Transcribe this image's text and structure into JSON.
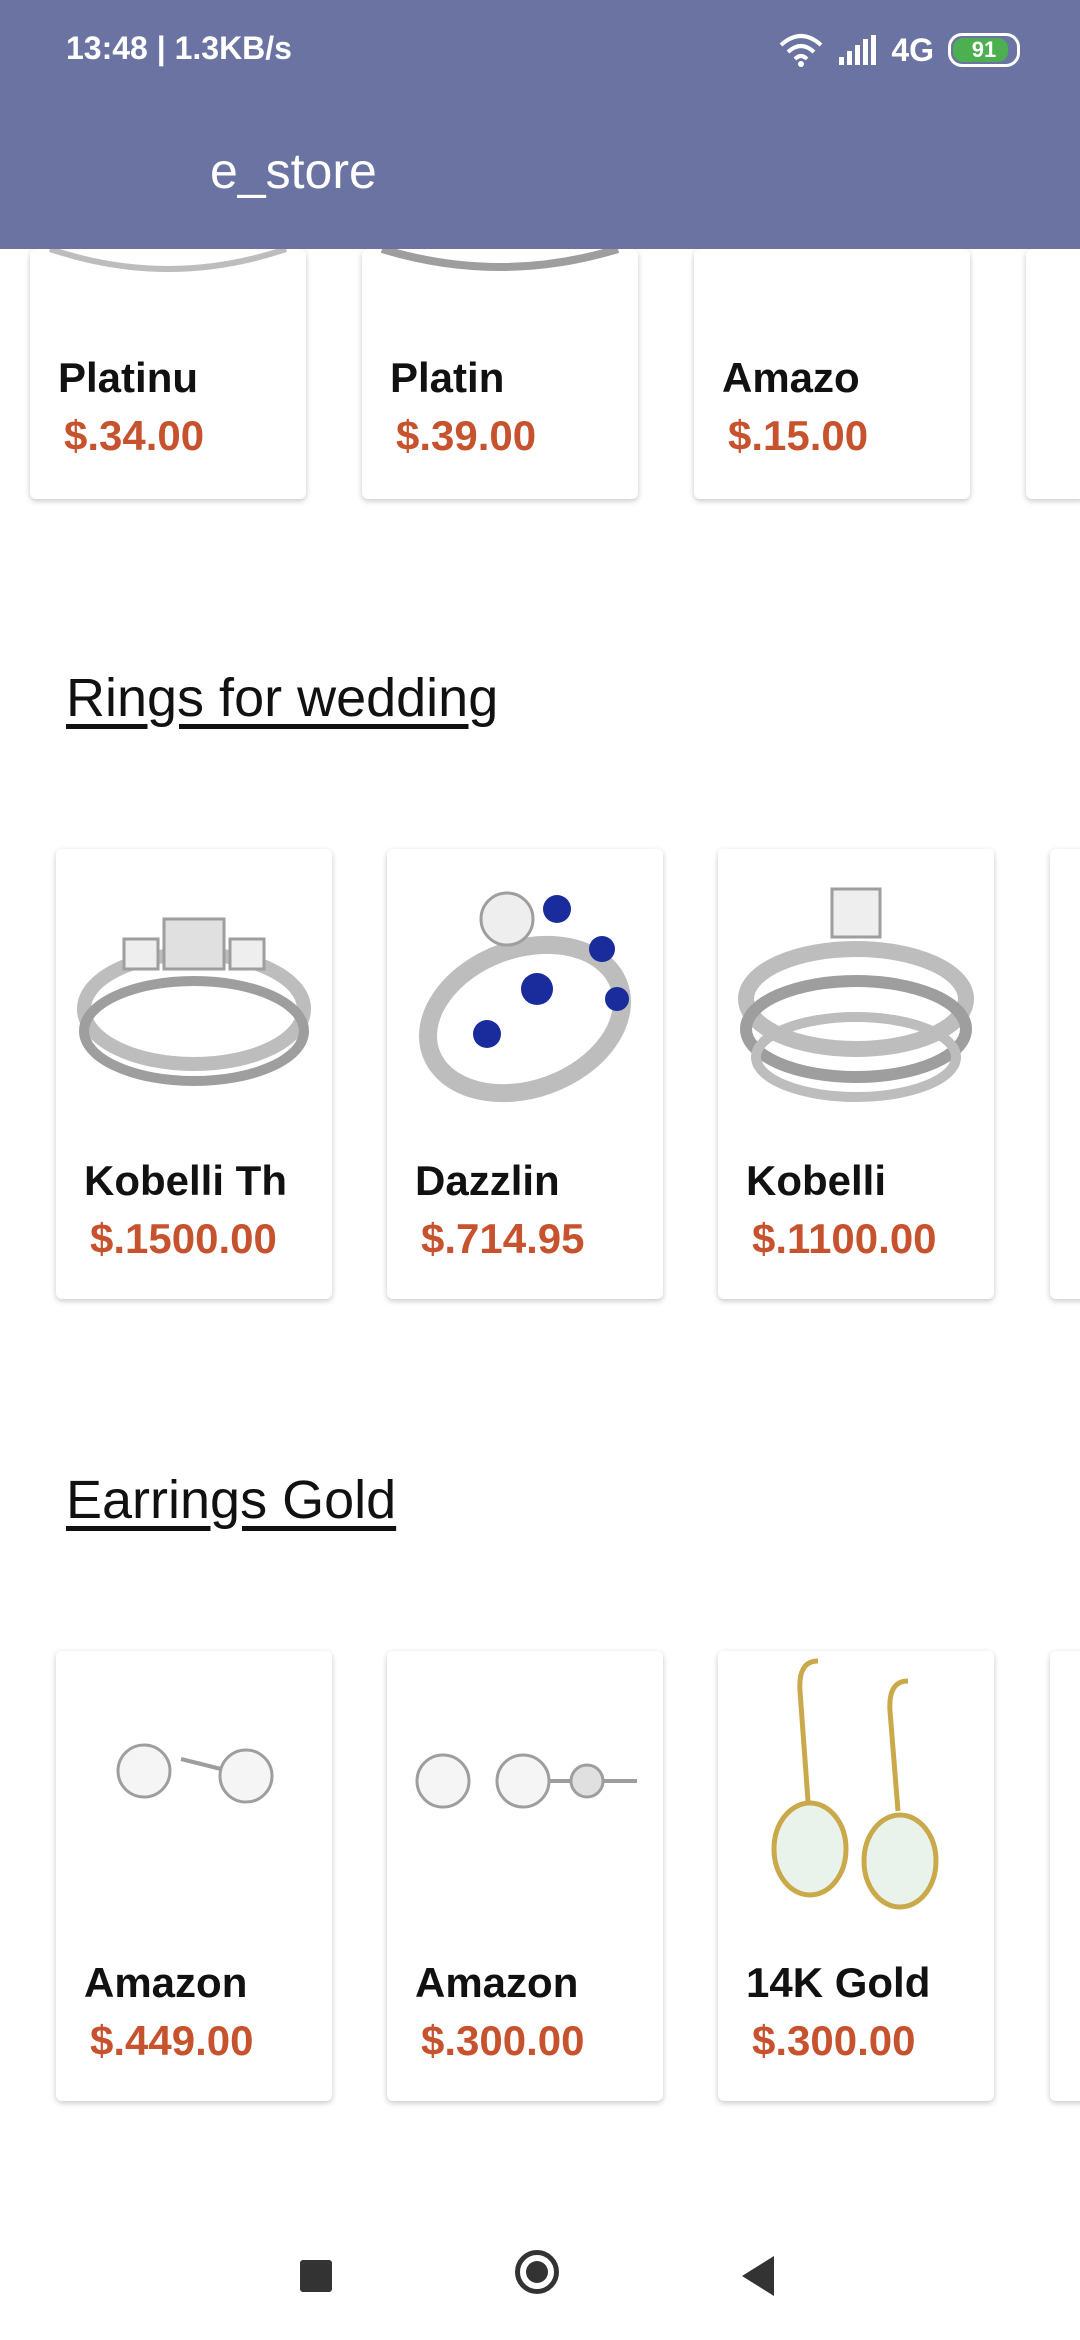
{
  "status_bar": {
    "time": "13:48 | 1.3KB/s",
    "network": "4G",
    "battery": "91"
  },
  "app": {
    "title": "e_store"
  },
  "top_products": [
    {
      "name": "Platinu",
      "price": "$.34.00"
    },
    {
      "name": "Platin",
      "price": "$.39.00"
    },
    {
      "name": "Amazo",
      "price": "$.15.00"
    }
  ],
  "sections": [
    {
      "title": "Rings for wedding",
      "products": [
        {
          "name": "Kobelli Th",
          "price": "$.1500.00"
        },
        {
          "name": "Dazzlin",
          "price": "$.714.95"
        },
        {
          "name": "Kobelli",
          "price": "$.1100.00"
        }
      ]
    },
    {
      "title": "Earrings Gold",
      "products": [
        {
          "name": "Amazon",
          "price": "$.449.00"
        },
        {
          "name": "Amazon",
          "price": "$.300.00"
        },
        {
          "name": "14K Gold",
          "price": "$.300.00"
        }
      ]
    }
  ],
  "colors": {
    "appbar": "#6b73a3",
    "price": "#c7522e"
  }
}
